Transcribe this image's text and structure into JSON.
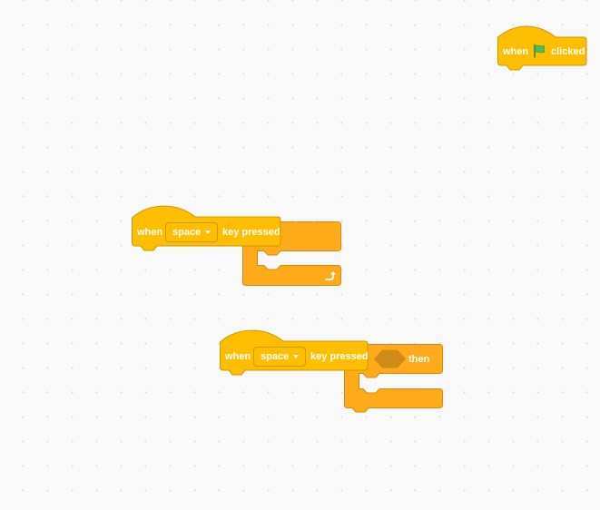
{
  "scripts": {
    "flag_script": {
      "when_label": "when",
      "clicked_label": "clicked",
      "flag_icon": "green-flag-icon"
    },
    "space_forever_script": {
      "when_label": "when",
      "key_value": "space",
      "key_pressed_label": "key pressed",
      "loop_arrow_icon": "loop-arrow-icon"
    },
    "space_if_script": {
      "when_label": "when",
      "key_value": "space",
      "key_pressed_label": "key pressed",
      "then_label": "then"
    }
  },
  "colors": {
    "events_fill": "#ffbf00",
    "events_stroke": "#cc9900",
    "control_fill": "#ffab19",
    "control_stroke": "#cf8b17",
    "empty_boolean_slot": "#cf8b17",
    "flag_green": "#4cbf56",
    "workspace_background": "#f9f9f9"
  }
}
